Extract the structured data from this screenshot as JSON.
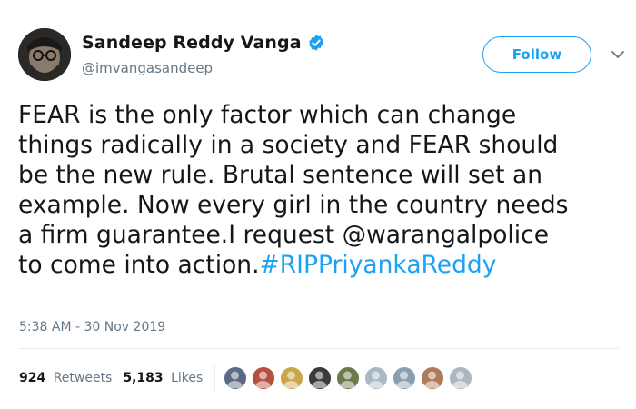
{
  "author": {
    "display_name": "Sandeep Reddy Vanga",
    "handle": "@imvangasandeep",
    "verified": true
  },
  "follow_label": "Follow",
  "tweet": {
    "text_part1": "FEAR is the only factor which can change\nthings radically in a society and FEAR should\nbe the new rule. Brutal sentence will set an\nexample. Now every girl in the country needs\na firm guarantee.I request ",
    "mention": "@warangalpolice",
    "text_part2": "\nto come into action.",
    "hashtag": "#RIPPriyankaReddy"
  },
  "timestamp": "5:38 AM - 30 Nov 2019",
  "stats": {
    "retweets_count": "924",
    "retweets_label": "Retweets",
    "likes_count": "5,183",
    "likes_label": "Likes"
  },
  "colors": {
    "accent": "#1da1f2",
    "text": "#14171a",
    "secondary": "#657786",
    "divider": "#e6ecf0"
  },
  "liker_avatars": [
    {
      "name": "liker-avatar-1",
      "color": "#5a6b82"
    },
    {
      "name": "liker-avatar-2",
      "color": "#b5503f"
    },
    {
      "name": "liker-avatar-3",
      "color": "#c9a64a"
    },
    {
      "name": "liker-avatar-4",
      "color": "#3b3b3b"
    },
    {
      "name": "liker-avatar-5",
      "color": "#6a7a4a"
    },
    {
      "name": "liker-avatar-6",
      "color": "#aab8c2"
    },
    {
      "name": "liker-avatar-7",
      "color": "#8aa0b0"
    },
    {
      "name": "liker-avatar-8",
      "color": "#b07a5a"
    },
    {
      "name": "liker-avatar-9",
      "color": "#aab8c2"
    }
  ]
}
